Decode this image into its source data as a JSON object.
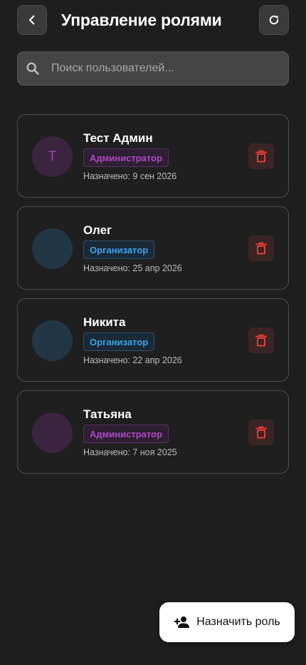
{
  "header": {
    "title": "Управление ролями",
    "back_icon": "chevron-left-icon",
    "refresh_icon": "refresh-icon"
  },
  "search": {
    "placeholder": "Поиск пользователей...",
    "value": "",
    "icon": "search-icon"
  },
  "users": [
    {
      "name": "Тест Админ",
      "initial": "Т",
      "role": "Администратор",
      "role_type": "admin",
      "assigned": "Назначено: 9 сен 2026"
    },
    {
      "name": "Олег",
      "initial": "",
      "role": "Организатор",
      "role_type": "org",
      "assigned": "Назначено: 25 апр 2026"
    },
    {
      "name": "Никита",
      "initial": "",
      "role": "Организатор",
      "role_type": "org",
      "assigned": "Назначено: 22 апр 2026"
    },
    {
      "name": "Татьяна",
      "initial": "",
      "role": "Администратор",
      "role_type": "admin",
      "assigned": "Назначено: 7 ноя 2025"
    }
  ],
  "fab": {
    "label": "Назначить роль",
    "icon": "person-add-icon"
  },
  "colors": {
    "background": "#1e1e1e",
    "admin_accent": "#b048c8",
    "organizer_accent": "#3ba2ea",
    "delete_accent": "#e53935"
  }
}
